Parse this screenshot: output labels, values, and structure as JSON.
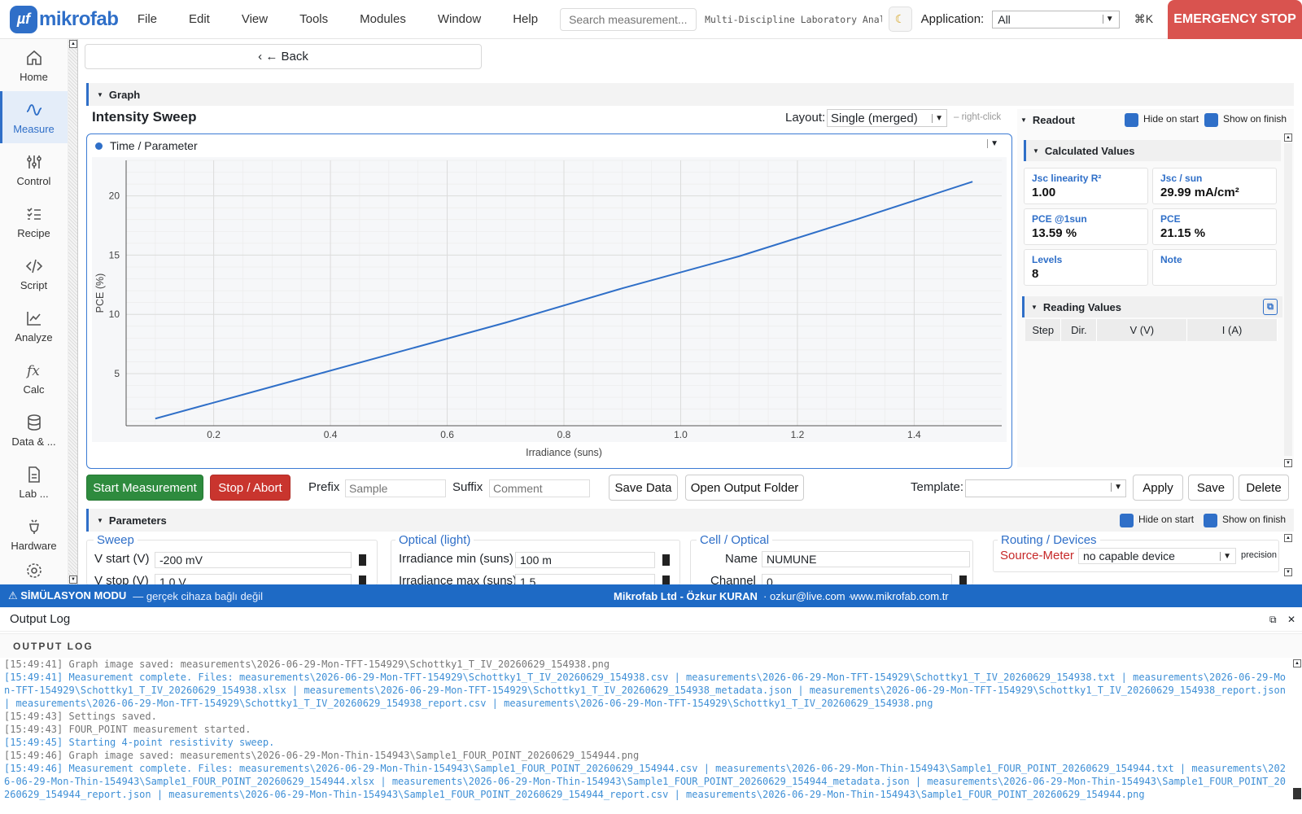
{
  "topbar": {
    "logo_mark": "µf",
    "logo_text": "mikrofab",
    "menu": [
      "File",
      "Edit",
      "View",
      "Tools",
      "Modules",
      "Window",
      "Help"
    ],
    "search_placeholder": "Search measurement...",
    "window_title": "Multi-Discipline Laboratory Anal…",
    "theme_icon": "moon-icon",
    "application_label": "Application:",
    "application_value": "All",
    "shortcut": "⌘K",
    "estop_label": "EMERGENCY STOP"
  },
  "sidebar": {
    "items": [
      {
        "label": "Home",
        "icon": "home-icon"
      },
      {
        "label": "Measure",
        "icon": "wave-icon",
        "active": true
      },
      {
        "label": "Control",
        "icon": "sliders-icon"
      },
      {
        "label": "Recipe",
        "icon": "checklist-icon"
      },
      {
        "label": "Script",
        "icon": "code-icon"
      },
      {
        "label": "Analyze",
        "icon": "chart-icon"
      },
      {
        "label": "Calc",
        "icon": "function-icon"
      },
      {
        "label": "Data & ...",
        "icon": "database-icon"
      },
      {
        "label": "Lab ...",
        "icon": "document-icon"
      },
      {
        "label": "Hardware",
        "icon": "plug-icon"
      }
    ]
  },
  "back_label": "‹ ← Back",
  "graph_section": {
    "title": "Graph"
  },
  "graph": {
    "title": "Intensity Sweep",
    "layout_label": "Layout:",
    "layout_value": "Single (merged)",
    "hint": "– right-click",
    "series_selector": "Time / Parameter"
  },
  "chart_data": {
    "type": "line",
    "xlabel": "Irradiance (suns)",
    "ylabel": "PCE (%)",
    "xlim": [
      0.05,
      1.55
    ],
    "ylim": [
      0.6,
      23
    ],
    "xticks": [
      0.2,
      0.4,
      0.6,
      0.8,
      1.0,
      1.2,
      1.4
    ],
    "xtick_labels": [
      "0.2",
      "0.4",
      "0.6",
      "0.8",
      "1.0",
      "1.2",
      "1.4"
    ],
    "yticks": [
      5,
      10,
      15,
      20
    ],
    "grid": true,
    "series": [
      {
        "color": "#2f6fc8",
        "x": [
          0.1,
          0.3,
          0.5,
          0.7,
          0.9,
          1.1,
          1.3,
          1.5
        ],
        "y": [
          1.2,
          3.9,
          6.6,
          9.3,
          12.2,
          14.9,
          18.0,
          21.2
        ]
      }
    ]
  },
  "readout": {
    "title": "Readout",
    "hide_on_start": "Hide on start",
    "show_on_finish": "Show on finish",
    "calc_title": "Calculated Values",
    "calc": [
      {
        "label": "Jsc linearity R²",
        "value": "1.00"
      },
      {
        "label": "Jsc / sun",
        "value": "29.99 mA/cm²"
      },
      {
        "label": "PCE @1sun",
        "value": "13.59 %"
      },
      {
        "label": "PCE",
        "value": "21.15 %"
      },
      {
        "label": "Levels",
        "value": "8"
      },
      {
        "label": "Note",
        "value": ""
      }
    ],
    "reading_title": "Reading Values",
    "columns": [
      "Step",
      "Dir.",
      "V (V)",
      "I (A)"
    ]
  },
  "actions": {
    "start": "Start Measurement",
    "stop": "Stop / Abort",
    "prefix_label": "Prefix",
    "prefix_placeholder": "Sample",
    "suffix_label": "Suffix",
    "suffix_placeholder": "Comment",
    "save_data": "Save Data",
    "open_folder": "Open Output Folder",
    "template_label": "Template:",
    "apply": "Apply",
    "save": "Save",
    "delete": "Delete"
  },
  "parameters": {
    "title": "Parameters",
    "hide_on_start": "Hide on start",
    "show_on_finish": "Show on finish",
    "sweep": {
      "title": "Sweep",
      "label1": "V start (V)",
      "value1": "-200 mV",
      "label2": "V stop (V)",
      "value2": "1.0 V"
    },
    "optical": {
      "title": "Optical (light)",
      "label1": "Irradiance min (suns)",
      "value1": "100 m",
      "label2": "Irradiance max (suns)",
      "value2": "1.5"
    },
    "cell": {
      "title": "Cell / Optical",
      "label1": "Name",
      "value1": "NUMUNE",
      "label2": "Channel",
      "value2": "0"
    },
    "routing": {
      "title": "Routing / Devices",
      "source_label": "Source-Meter",
      "source_value": "no capable device",
      "precision": "precision"
    }
  },
  "statusbar": {
    "mode": "⚠ SİMÜLASYON MODU",
    "mode_sub": "— gerçek cihaza bağlı değil",
    "credits": "Mikrofab Ltd - Özkur KURAN",
    "email": "· ozkur@live.com ·",
    "site": "www.mikrofab.com.tr"
  },
  "log": {
    "title": "Output Log",
    "subtitle": "OUTPUT LOG",
    "lines": [
      {
        "kind": "gray",
        "text": "[15:49:41] Graph image saved: measurements\\2026-06-29-Mon-TFT-154929\\Schottky1_T_IV_20260629_154938.png"
      },
      {
        "kind": "blue",
        "text": "[15:49:41] Measurement complete. Files: measurements\\2026-06-29-Mon-TFT-154929\\Schottky1_T_IV_20260629_154938.csv | measurements\\2026-06-29-Mon-TFT-154929\\Schottky1_T_IV_20260629_154938.txt | measurements\\2026-06-29-Mon-TFT-154929\\Schottky1_T_IV_20260629_154938.xlsx | measurements\\2026-06-29-Mon-TFT-154929\\Schottky1_T_IV_20260629_154938_metadata.json | measurements\\2026-06-29-Mon-TFT-154929\\Schottky1_T_IV_20260629_154938_report.json | measurements\\2026-06-29-Mon-TFT-154929\\Schottky1_T_IV_20260629_154938_report.csv | measurements\\2026-06-29-Mon-TFT-154929\\Schottky1_T_IV_20260629_154938.png"
      },
      {
        "kind": "gray",
        "text": "[15:49:43] Settings saved."
      },
      {
        "kind": "gray",
        "text": "[15:49:43] FOUR_POINT measurement started."
      },
      {
        "kind": "blue",
        "text": "[15:49:45] Starting 4-point resistivity sweep."
      },
      {
        "kind": "gray",
        "text": "[15:49:46] Graph image saved: measurements\\2026-06-29-Mon-Thin-154943\\Sample1_FOUR_POINT_20260629_154944.png"
      },
      {
        "kind": "blue",
        "text": "[15:49:46] Measurement complete. Files: measurements\\2026-06-29-Mon-Thin-154943\\Sample1_FOUR_POINT_20260629_154944.csv | measurements\\2026-06-29-Mon-Thin-154943\\Sample1_FOUR_POINT_20260629_154944.txt | measurements\\2026-06-29-Mon-Thin-154943\\Sample1_FOUR_POINT_20260629_154944.xlsx | measurements\\2026-06-29-Mon-Thin-154943\\Sample1_FOUR_POINT_20260629_154944_metadata.json | measurements\\2026-06-29-Mon-Thin-154943\\Sample1_FOUR_POINT_20260629_154944_report.json | measurements\\2026-06-29-Mon-Thin-154943\\Sample1_FOUR_POINT_20260629_154944_report.csv | measurements\\2026-06-29-Mon-Thin-154943\\Sample1_FOUR_POINT_20260629_154944.png"
      }
    ]
  }
}
